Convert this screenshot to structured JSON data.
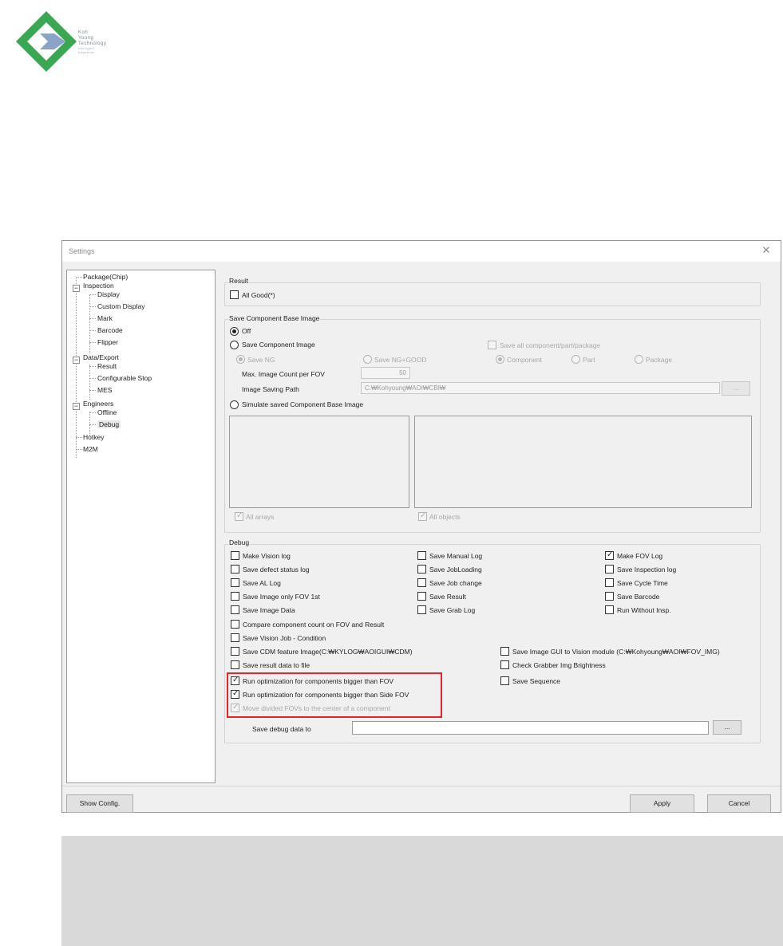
{
  "logo": {
    "line1": "Koh",
    "line2": "Young",
    "line3": "Technology",
    "line4": "intelligent",
    "line5": "inspection",
    "colors": {
      "diamond": "#3aa853",
      "arrow": "#8ba3c7"
    }
  },
  "window": {
    "title": "Settings",
    "close_icon": "close-icon"
  },
  "tree": {
    "items": [
      {
        "label": "Package(Chip)"
      },
      {
        "label": "Inspection"
      },
      {
        "label": "Display"
      },
      {
        "label": "Custom Display"
      },
      {
        "label": "Mark"
      },
      {
        "label": "Barcode"
      },
      {
        "label": "Flipper"
      },
      {
        "label": "Data/Export"
      },
      {
        "label": "Result"
      },
      {
        "label": "Configurable Stop"
      },
      {
        "label": "MES"
      },
      {
        "label": "Engineers"
      },
      {
        "label": "Offline"
      },
      {
        "label": "Debug"
      },
      {
        "label": "Hotkey"
      },
      {
        "label": "M2M"
      }
    ]
  },
  "result": {
    "title": "Result",
    "all_good": "All Good(*)"
  },
  "component_image": {
    "title": "Save Component Base Image",
    "off": "Off",
    "save_component_image": "Save Component Image",
    "save_all": "Save all component/part/package",
    "save_ng": "Save NG",
    "save_ng_good": "Save NG+GOOD",
    "component": "Component",
    "part": "Part",
    "package": "Package",
    "max_count_label": "Max. Image Count per FOV",
    "max_count_value": "50",
    "path_label": "Image Saving Path",
    "path_value": "C:₩Kohyoung₩AOI₩CBI₩",
    "browse": "...",
    "simulate": "Simulate saved Component Base Image",
    "all_arrays": "All arrays",
    "all_objects": "All objects"
  },
  "debug": {
    "title": "Debug",
    "col1": [
      {
        "label": "Make Vision log",
        "checked": false
      },
      {
        "label": "Save defect status log",
        "checked": false
      },
      {
        "label": "Save AL Log",
        "checked": false
      },
      {
        "label": "Save Image only FOV 1st",
        "checked": false
      },
      {
        "label": "Save Image Data",
        "checked": false
      }
    ],
    "col2": [
      {
        "label": "Save Manual Log",
        "checked": false
      },
      {
        "label": "Save JobLoading",
        "checked": false
      },
      {
        "label": "Save Job change",
        "checked": false
      },
      {
        "label": "Save Result",
        "checked": false
      },
      {
        "label": "Save Grab Log",
        "checked": false
      }
    ],
    "col3": [
      {
        "label": "Make FOV Log",
        "checked": true
      },
      {
        "label": "Save Inspection log",
        "checked": false
      },
      {
        "label": "Save Cycle Time",
        "checked": false
      },
      {
        "label": "Save Barcode",
        "checked": false
      },
      {
        "label": "Run Without Insp.",
        "checked": false
      }
    ],
    "compare_count": "Compare component count on FOV and Result",
    "save_vision_job": "Save Vision Job - Condition",
    "save_cdm": "Save CDM feature Image(C:₩KYLOG₩AOIGUI₩CDM)",
    "save_result_file": "Save result data to file",
    "save_image_gui": "Save Image GUI to Vision module (C:₩Kohyoung₩AOI₩FOV_IMG)",
    "check_grabber": "Check Grabber Img Brightness",
    "save_sequence": "Save Sequence",
    "run_opt_fov": "Run optimization for components bigger than FOV",
    "run_opt_side_fov": "Run optimization for components bigger than Side FOV",
    "move_divided": "Move divided FOVs to the center of a component",
    "save_to_label": "Save debug data to",
    "save_to_value": "",
    "browse": "..."
  },
  "buttons": {
    "show_config": "Show Config.",
    "apply": "Apply",
    "cancel": "Cancel"
  },
  "highlight_color": "#e8232a"
}
